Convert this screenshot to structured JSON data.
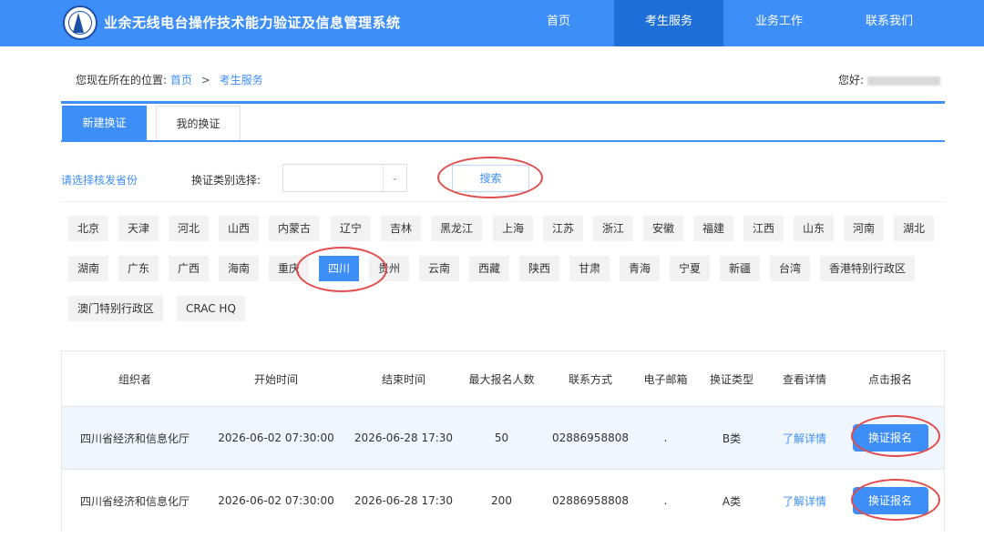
{
  "header": {
    "system_title": "业余无线电台操作技术能力验证及信息管理系统",
    "nav": [
      {
        "label": "首页",
        "active": false
      },
      {
        "label": "考生服务",
        "active": true
      },
      {
        "label": "业务工作",
        "active": false
      },
      {
        "label": "联系我们",
        "active": false
      }
    ]
  },
  "breadcrumb": {
    "prefix": "您现在所在的位置:",
    "items": [
      "首页",
      "考生服务"
    ],
    "separator": ">"
  },
  "user": {
    "greeting": "您好:"
  },
  "tabs": [
    {
      "label": "新建换证",
      "active": true
    },
    {
      "label": "我的换证",
      "active": false
    }
  ],
  "filter": {
    "province_prompt": "请选择核发省份",
    "type_label": "换证类别选择:",
    "type_value": "",
    "search_label": "搜索"
  },
  "provinces": {
    "selected": "四川",
    "items": [
      "北京",
      "天津",
      "河北",
      "山西",
      "内蒙古",
      "辽宁",
      "吉林",
      "黑龙江",
      "上海",
      "江苏",
      "浙江",
      "安徽",
      "福建",
      "江西",
      "山东",
      "河南",
      "湖北",
      "湖南",
      "广东",
      "广西",
      "海南",
      "重庆",
      "四川",
      "贵州",
      "云南",
      "西藏",
      "陕西",
      "甘肃",
      "青海",
      "宁夏",
      "新疆",
      "台湾",
      "香港特别行政区",
      "澳门特别行政区",
      "CRAC HQ"
    ]
  },
  "table": {
    "headers": [
      "组织者",
      "开始时间",
      "结束时间",
      "最大报名人数",
      "联系方式",
      "电子邮箱",
      "换证类型",
      "查看详情",
      "点击报名"
    ],
    "rows": [
      {
        "organizer": "四川省经济和信息化厅",
        "start": "2026-06-02 07:30:00",
        "end": "2026-06-28 17:30",
        "max": "50",
        "contact": "02886958808",
        "email": ".",
        "type": "B类",
        "detail": "了解详情",
        "apply": "换证报名"
      },
      {
        "organizer": "四川省经济和信息化厅",
        "start": "2026-06-02 07:30:00",
        "end": "2026-06-28 17:30",
        "max": "200",
        "contact": "02886958808",
        "email": ".",
        "type": "A类",
        "detail": "了解详情",
        "apply": "换证报名"
      }
    ]
  },
  "colors": {
    "accent": "#3e8ef7",
    "nav_active": "#1f6fd9",
    "annotation": "#e24b4b"
  }
}
